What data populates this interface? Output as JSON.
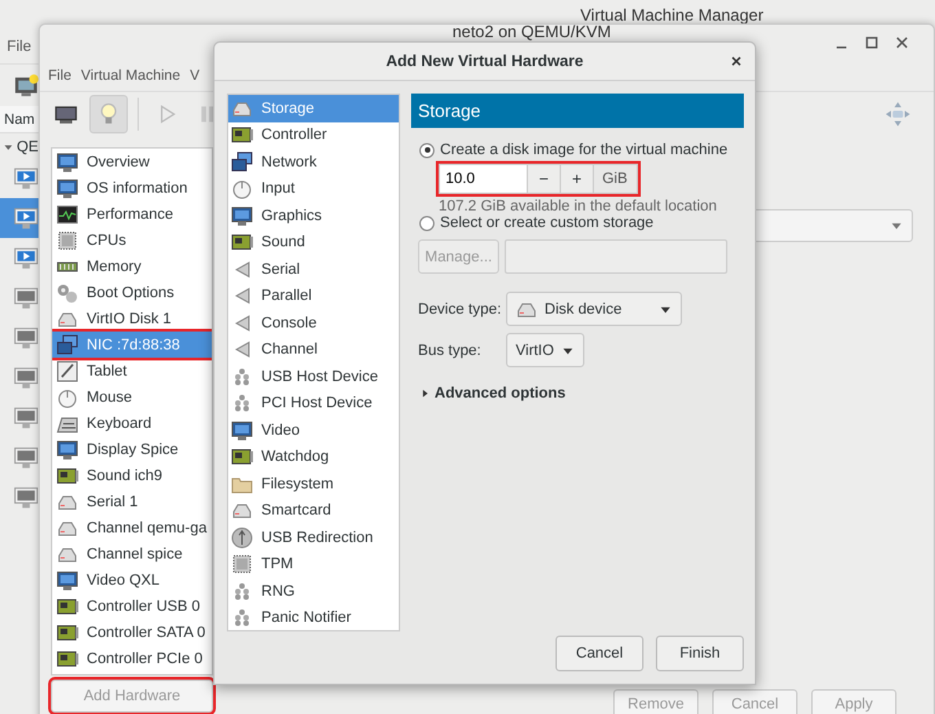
{
  "manager_window": {
    "title": "Virtual Machine Manager",
    "menu": [
      "File"
    ],
    "column_header": "Nam",
    "tree_root": "QE",
    "vms": [
      {
        "running": true,
        "selected": false
      },
      {
        "running": true,
        "selected": true
      },
      {
        "running": true,
        "selected": false
      },
      {
        "running": false,
        "selected": false
      },
      {
        "running": false,
        "selected": false
      },
      {
        "running": false,
        "selected": false
      },
      {
        "running": false,
        "selected": false
      },
      {
        "running": false,
        "selected": false
      },
      {
        "running": false,
        "selected": false
      }
    ]
  },
  "vm_window": {
    "title": "neto2 on QEMU/KVM",
    "menu": [
      "File",
      "Virtual Machine",
      "V"
    ],
    "hardware": [
      {
        "label": "Overview",
        "selected": false,
        "highlighted": false
      },
      {
        "label": "OS information",
        "selected": false,
        "highlighted": false
      },
      {
        "label": "Performance",
        "selected": false,
        "highlighted": false
      },
      {
        "label": "CPUs",
        "selected": false,
        "highlighted": false
      },
      {
        "label": "Memory",
        "selected": false,
        "highlighted": false
      },
      {
        "label": "Boot Options",
        "selected": false,
        "highlighted": false
      },
      {
        "label": "VirtIO Disk 1",
        "selected": false,
        "highlighted": false
      },
      {
        "label": "NIC :7d:88:38",
        "selected": true,
        "highlighted": true
      },
      {
        "label": "Tablet",
        "selected": false,
        "highlighted": false
      },
      {
        "label": "Mouse",
        "selected": false,
        "highlighted": false
      },
      {
        "label": "Keyboard",
        "selected": false,
        "highlighted": false
      },
      {
        "label": "Display Spice",
        "selected": false,
        "highlighted": false
      },
      {
        "label": "Sound ich9",
        "selected": false,
        "highlighted": false
      },
      {
        "label": "Serial 1",
        "selected": false,
        "highlighted": false
      },
      {
        "label": "Channel qemu-ga",
        "selected": false,
        "highlighted": false
      },
      {
        "label": "Channel spice",
        "selected": false,
        "highlighted": false
      },
      {
        "label": "Video QXL",
        "selected": false,
        "highlighted": false
      },
      {
        "label": "Controller USB 0",
        "selected": false,
        "highlighted": false
      },
      {
        "label": "Controller SATA 0",
        "selected": false,
        "highlighted": false
      },
      {
        "label": "Controller PCIe 0",
        "selected": false,
        "highlighted": false
      }
    ],
    "add_button": {
      "label": "Add Hardware",
      "disabled": true,
      "highlighted": true
    },
    "buttons": [
      "Remove",
      "Cancel",
      "Apply"
    ]
  },
  "dialog": {
    "title": "Add New Virtual Hardware",
    "types": [
      {
        "label": "Storage",
        "selected": true
      },
      {
        "label": "Controller",
        "selected": false
      },
      {
        "label": "Network",
        "selected": false
      },
      {
        "label": "Input",
        "selected": false
      },
      {
        "label": "Graphics",
        "selected": false
      },
      {
        "label": "Sound",
        "selected": false
      },
      {
        "label": "Serial",
        "selected": false
      },
      {
        "label": "Parallel",
        "selected": false
      },
      {
        "label": "Console",
        "selected": false
      },
      {
        "label": "Channel",
        "selected": false
      },
      {
        "label": "USB Host Device",
        "selected": false
      },
      {
        "label": "PCI Host Device",
        "selected": false
      },
      {
        "label": "Video",
        "selected": false
      },
      {
        "label": "Watchdog",
        "selected": false
      },
      {
        "label": "Filesystem",
        "selected": false
      },
      {
        "label": "Smartcard",
        "selected": false
      },
      {
        "label": "USB Redirection",
        "selected": false
      },
      {
        "label": "TPM",
        "selected": false
      },
      {
        "label": "RNG",
        "selected": false
      },
      {
        "label": "Panic Notifier",
        "selected": false
      }
    ],
    "section_title": "Storage",
    "create_option": {
      "label": "Create a disk image for the virtual machine",
      "selected": true
    },
    "size": {
      "value": "10.0",
      "minus": "−",
      "plus": "+",
      "unit": "GiB",
      "highlighted": true
    },
    "available": "107.2 GiB available in the default location",
    "custom_option": {
      "label": "Select or create custom storage",
      "selected": false
    },
    "manage_button": {
      "label": "Manage...",
      "disabled": true
    },
    "device_type": {
      "label": "Device type:",
      "value": "Disk device"
    },
    "bus_type": {
      "label": "Bus type:",
      "value": "VirtIO"
    },
    "advanced": {
      "label": "Advanced options",
      "expanded": false
    },
    "buttons": [
      "Cancel",
      "Finish"
    ]
  }
}
